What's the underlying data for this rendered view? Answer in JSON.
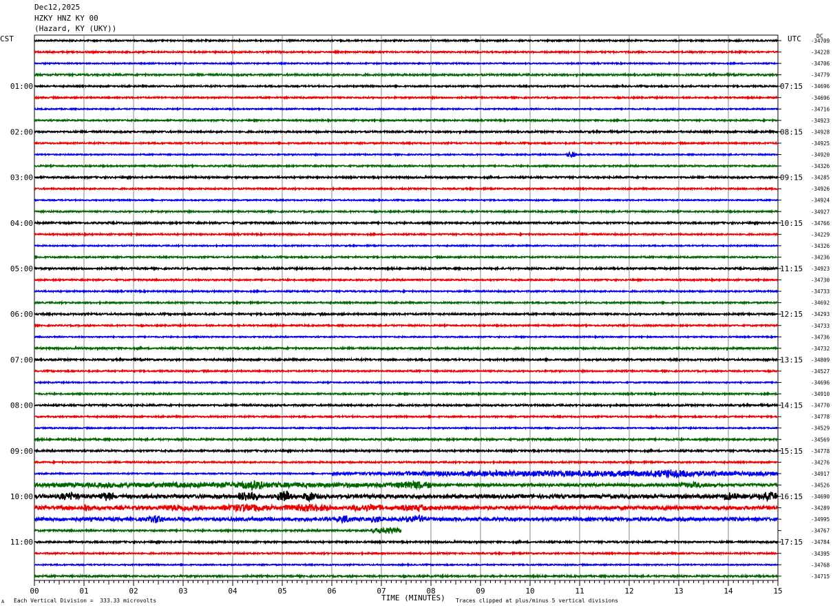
{
  "header": {
    "date": "Dec12,2025",
    "station": "HZKY HNZ KY 00",
    "location": "(Hazard, KY (UKY))"
  },
  "axes": {
    "left_timezone": "CST",
    "right_timezone": "UTC",
    "dc_label": "DC",
    "x_title": "TIME (MINUTES)"
  },
  "footer": {
    "scale_note": "Each Vertical Division =  333.33 microvolts",
    "clip_note": "Traces clipped at plus/minus 5 vertical divisions",
    "corner_mark": "A"
  },
  "chart_data": {
    "type": "line",
    "title": "HZKY HNZ KY 00",
    "xlabel": "TIME (MINUTES)",
    "xlim": [
      0,
      15
    ],
    "x_ticks": [
      "00",
      "01",
      "02",
      "03",
      "04",
      "05",
      "06",
      "07",
      "08",
      "09",
      "10",
      "11",
      "12",
      "13",
      "14",
      "15"
    ],
    "trace_colors": [
      "#000000",
      "#ee0000",
      "#0000ee",
      "#006600"
    ],
    "left_time_labels": [
      {
        "row": 4,
        "text": "01:00"
      },
      {
        "row": 8,
        "text": "02:00"
      },
      {
        "row": 12,
        "text": "03:00"
      },
      {
        "row": 16,
        "text": "04:00"
      },
      {
        "row": 20,
        "text": "05:00"
      },
      {
        "row": 24,
        "text": "06:00"
      },
      {
        "row": 28,
        "text": "07:00"
      },
      {
        "row": 32,
        "text": "08:00"
      },
      {
        "row": 36,
        "text": "09:00"
      },
      {
        "row": 40,
        "text": "10:00"
      },
      {
        "row": 44,
        "text": "11:00"
      }
    ],
    "right_time_labels": [
      {
        "row": 4,
        "text": "07:15"
      },
      {
        "row": 8,
        "text": "08:15"
      },
      {
        "row": 12,
        "text": "09:15"
      },
      {
        "row": 16,
        "text": "10:15"
      },
      {
        "row": 20,
        "text": "11:15"
      },
      {
        "row": 24,
        "text": "12:15"
      },
      {
        "row": 28,
        "text": "13:15"
      },
      {
        "row": 32,
        "text": "14:15"
      },
      {
        "row": 36,
        "text": "15:15"
      },
      {
        "row": 40,
        "text": "16:15"
      },
      {
        "row": 44,
        "text": "17:15"
      }
    ],
    "dc_offsets": [
      "-34709",
      "-34228",
      "-34706",
      "-34779",
      "-34696",
      "-34696",
      "-34716",
      "-34923",
      "-34928",
      "-34925",
      "-34920",
      "-34326",
      "-34285",
      "-34926",
      "-34924",
      "-34927",
      "-34766",
      "-34229",
      "-34326",
      "-34236",
      "-34923",
      "-34730",
      "-34733",
      "-34692",
      "-34293",
      "-34733",
      "-34736",
      "-34732",
      "-34809",
      "-34527",
      "-34696",
      "-34910",
      "-34770",
      "-34778",
      "-34529",
      "-34569",
      "-34778",
      "-34276",
      "-34917",
      "-34526",
      "-34690",
      "-34289",
      "-34995",
      "-34767",
      "-34784",
      "-34395",
      "-34768",
      "-34715"
    ],
    "traces": [
      {
        "row": 0,
        "color": "#000000",
        "amplitude": 0.12,
        "bursts": []
      },
      {
        "row": 1,
        "color": "#ee0000",
        "amplitude": 0.12,
        "bursts": []
      },
      {
        "row": 2,
        "color": "#0000ee",
        "amplitude": 0.1,
        "bursts": []
      },
      {
        "row": 3,
        "color": "#006600",
        "amplitude": 0.14,
        "bursts": []
      },
      {
        "row": 4,
        "color": "#000000",
        "amplitude": 0.12,
        "bursts": []
      },
      {
        "row": 5,
        "color": "#ee0000",
        "amplitude": 0.12,
        "bursts": []
      },
      {
        "row": 6,
        "color": "#0000ee",
        "amplitude": 0.1,
        "bursts": []
      },
      {
        "row": 7,
        "color": "#006600",
        "amplitude": 0.12,
        "bursts": []
      },
      {
        "row": 8,
        "color": "#000000",
        "amplitude": 0.14,
        "bursts": []
      },
      {
        "row": 9,
        "color": "#ee0000",
        "amplitude": 0.12,
        "bursts": []
      },
      {
        "row": 10,
        "color": "#0000ee",
        "amplitude": 0.1,
        "bursts": [
          {
            "start": 10.75,
            "end": 10.95,
            "gain": 0.55
          }
        ]
      },
      {
        "row": 11,
        "color": "#006600",
        "amplitude": 0.12,
        "bursts": []
      },
      {
        "row": 12,
        "color": "#000000",
        "amplitude": 0.14,
        "bursts": []
      },
      {
        "row": 13,
        "color": "#ee0000",
        "amplitude": 0.12,
        "bursts": []
      },
      {
        "row": 14,
        "color": "#0000ee",
        "amplitude": 0.1,
        "bursts": []
      },
      {
        "row": 15,
        "color": "#006600",
        "amplitude": 0.12,
        "bursts": []
      },
      {
        "row": 16,
        "color": "#000000",
        "amplitude": 0.14,
        "bursts": []
      },
      {
        "row": 17,
        "color": "#ee0000",
        "amplitude": 0.12,
        "bursts": []
      },
      {
        "row": 18,
        "color": "#0000ee",
        "amplitude": 0.1,
        "bursts": []
      },
      {
        "row": 19,
        "color": "#006600",
        "amplitude": 0.12,
        "bursts": []
      },
      {
        "row": 20,
        "color": "#000000",
        "amplitude": 0.14,
        "bursts": []
      },
      {
        "row": 21,
        "color": "#ee0000",
        "amplitude": 0.12,
        "bursts": []
      },
      {
        "row": 22,
        "color": "#0000ee",
        "amplitude": 0.12,
        "bursts": []
      },
      {
        "row": 23,
        "color": "#006600",
        "amplitude": 0.12,
        "bursts": []
      },
      {
        "row": 24,
        "color": "#000000",
        "amplitude": 0.14,
        "bursts": []
      },
      {
        "row": 25,
        "color": "#ee0000",
        "amplitude": 0.12,
        "bursts": []
      },
      {
        "row": 26,
        "color": "#0000ee",
        "amplitude": 0.1,
        "bursts": []
      },
      {
        "row": 27,
        "color": "#006600",
        "amplitude": 0.14,
        "bursts": []
      },
      {
        "row": 28,
        "color": "#000000",
        "amplitude": 0.14,
        "bursts": []
      },
      {
        "row": 29,
        "color": "#ee0000",
        "amplitude": 0.12,
        "bursts": []
      },
      {
        "row": 30,
        "color": "#0000ee",
        "amplitude": 0.1,
        "bursts": []
      },
      {
        "row": 31,
        "color": "#006600",
        "amplitude": 0.12,
        "bursts": []
      },
      {
        "row": 32,
        "color": "#000000",
        "amplitude": 0.14,
        "bursts": []
      },
      {
        "row": 33,
        "color": "#ee0000",
        "amplitude": 0.12,
        "bursts": []
      },
      {
        "row": 34,
        "color": "#0000ee",
        "amplitude": 0.1,
        "bursts": []
      },
      {
        "row": 35,
        "color": "#006600",
        "amplitude": 0.14,
        "bursts": []
      },
      {
        "row": 36,
        "color": "#000000",
        "amplitude": 0.14,
        "bursts": []
      },
      {
        "row": 37,
        "color": "#ee0000",
        "amplitude": 0.12,
        "bursts": []
      },
      {
        "row": 38,
        "color": "#0000ee",
        "amplitude": 0.1,
        "bursts": [
          {
            "start": 6.0,
            "end": 15.0,
            "gain": 0.25
          },
          {
            "start": 7.5,
            "end": 15.0,
            "gain": 0.3
          },
          {
            "start": 12.5,
            "end": 13.3,
            "gain": 0.35
          }
        ]
      },
      {
        "row": 39,
        "color": "#006600",
        "amplitude": 0.22,
        "bursts": [
          {
            "start": 0.0,
            "end": 8.0,
            "gain": 0.3
          },
          {
            "start": 4.2,
            "end": 4.6,
            "gain": 0.5
          },
          {
            "start": 7.3,
            "end": 8.0,
            "gain": 0.4
          },
          {
            "start": 13.0,
            "end": 13.6,
            "gain": 0.3
          }
        ]
      },
      {
        "row": 40,
        "color": "#000000",
        "amplitude": 0.3,
        "bursts": [
          {
            "start": 0.5,
            "end": 0.9,
            "gain": 0.5
          },
          {
            "start": 1.3,
            "end": 1.6,
            "gain": 0.6
          },
          {
            "start": 4.1,
            "end": 4.5,
            "gain": 0.8
          },
          {
            "start": 4.9,
            "end": 5.2,
            "gain": 0.8
          },
          {
            "start": 5.4,
            "end": 5.7,
            "gain": 0.6
          },
          {
            "start": 13.9,
            "end": 14.2,
            "gain": 0.5
          },
          {
            "start": 14.6,
            "end": 15.0,
            "gain": 0.6
          }
        ]
      },
      {
        "row": 41,
        "color": "#ee0000",
        "amplitude": 0.3,
        "bursts": [
          {
            "start": 1.0,
            "end": 1.1,
            "gain": 0.7
          },
          {
            "start": 2.5,
            "end": 3.5,
            "gain": 0.3
          },
          {
            "start": 3.8,
            "end": 4.8,
            "gain": 0.5
          },
          {
            "start": 5.0,
            "end": 6.0,
            "gain": 0.4
          },
          {
            "start": 6.4,
            "end": 7.0,
            "gain": 0.4
          },
          {
            "start": 7.4,
            "end": 8.0,
            "gain": 0.4
          }
        ]
      },
      {
        "row": 42,
        "color": "#0000ee",
        "amplitude": 0.28,
        "bursts": [
          {
            "start": 2.3,
            "end": 2.6,
            "gain": 0.45
          },
          {
            "start": 6.1,
            "end": 6.4,
            "gain": 0.5
          },
          {
            "start": 6.8,
            "end": 7.0,
            "gain": 0.45
          },
          {
            "start": 7.5,
            "end": 7.9,
            "gain": 0.5
          }
        ]
      },
      {
        "row": 43,
        "color": "#006600",
        "amplitude": 0.14,
        "bursts": [
          {
            "start": 6.8,
            "end": 7.4,
            "gain": 0.55
          }
        ],
        "end": 7.4
      },
      {
        "row": 44,
        "color": "#000000",
        "amplitude": 0.14,
        "bursts": []
      },
      {
        "row": 45,
        "color": "#ee0000",
        "amplitude": 0.12,
        "bursts": []
      },
      {
        "row": 46,
        "color": "#0000ee",
        "amplitude": 0.1,
        "bursts": []
      },
      {
        "row": 47,
        "color": "#006600",
        "amplitude": 0.14,
        "bursts": []
      }
    ]
  }
}
